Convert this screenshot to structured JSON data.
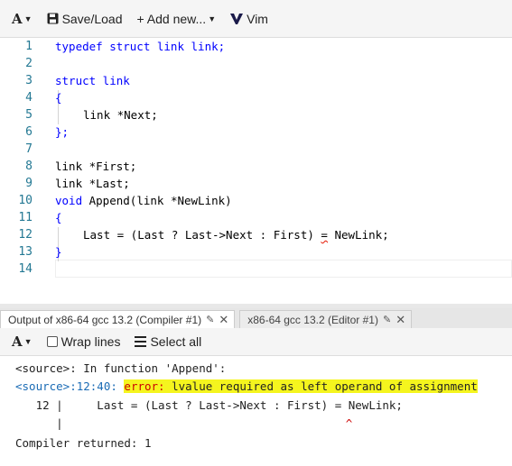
{
  "toolbar": {
    "font_icon": "A",
    "save_label": "Save/Load",
    "add_label": "+ Add new...",
    "vim_label": "Vim"
  },
  "editor": {
    "line_numbers": [
      "1",
      "2",
      "3",
      "4",
      "5",
      "6",
      "7",
      "8",
      "9",
      "10",
      "11",
      "12",
      "13",
      "14"
    ],
    "lines": {
      "l1": "typedef struct link link;",
      "l3": "struct link",
      "l4": "{",
      "l5": "link *Next;",
      "l6": "};",
      "l8": "link *First;",
      "l9": "link *Last;",
      "l10_kw": "void",
      "l10_rest": " Append(link *NewLink)",
      "l11": "{",
      "l12_a": "Last = (Last ? Last->Next : First) ",
      "l12_eq": "=",
      "l12_b": " NewLink;",
      "l13": "}"
    }
  },
  "tabs": [
    {
      "label": "Output of x86-64 gcc 13.2 (Compiler #1)"
    },
    {
      "label": "x86-64 gcc 13.2 (Editor #1)"
    }
  ],
  "output_toolbar": {
    "font_icon": "A",
    "wrap_label": "Wrap lines",
    "select_label": "Select all"
  },
  "output": {
    "line1": "<source>: In function 'Append':",
    "line2_loc": "<source>:12:40:",
    "line2_err": "error:",
    "line2_msg": " lvalue required as left operand of assignment",
    "line3": "   12 |     Last = (Last ? Last->Next : First) = NewLink;",
    "line4_bar": "      |",
    "line4_caret": "^",
    "line5": "Compiler returned: 1"
  },
  "colors": {
    "keyword": "#0000ff",
    "line_number": "#237893",
    "error": "#cc0000",
    "highlight": "#f5f51e"
  }
}
